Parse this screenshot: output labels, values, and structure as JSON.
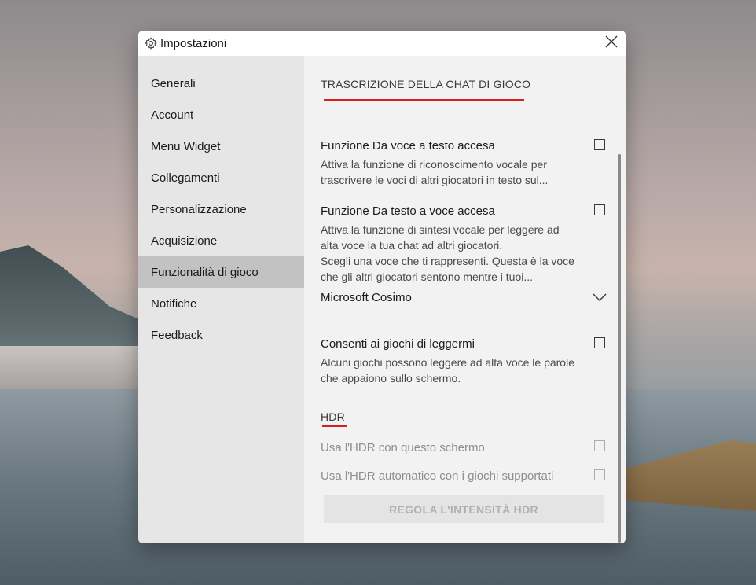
{
  "window": {
    "title": "Impostazioni",
    "settings_icon": "gear-icon",
    "close_icon": "close-icon"
  },
  "sidebar": {
    "items": [
      {
        "label": "Generali"
      },
      {
        "label": "Account"
      },
      {
        "label": "Menu Widget"
      },
      {
        "label": "Collegamenti"
      },
      {
        "label": "Personalizzazione"
      },
      {
        "label": "Acquisizione"
      },
      {
        "label": "Funzionalità di gioco",
        "active": true
      },
      {
        "label": "Notifiche"
      },
      {
        "label": "Feedback"
      }
    ]
  },
  "content": {
    "chat_section": {
      "title": "TRASCRIZIONE DELLA CHAT DI GIOCO",
      "speech_to_text": {
        "title": "Funzione Da voce a testo accesa",
        "desc_line1": "Attiva la funzione di riconoscimento vocale per",
        "desc_line2": "trascrivere le voci di altri giocatori in testo sul...",
        "checked": false
      },
      "text_to_speech": {
        "title": "Funzione Da testo a voce accesa",
        "desc_line1": "Attiva la funzione di sintesi vocale per leggere ad",
        "desc_line2": "alta voce la tua chat ad altri giocatori.",
        "desc_line3": "Scegli una voce che ti rappresenti. Questa è la voce",
        "desc_line4": "che gli altri giocatori sentono mentre i tuoi...",
        "checked": false
      },
      "voice_dropdown": {
        "selected": "Microsoft Cosimo",
        "icon": "chevron-down-icon"
      },
      "read_to_me": {
        "title": "Consenti ai giochi di leggermi",
        "desc_line1": "Alcuni giochi possono leggere ad alta voce le parole",
        "desc_line2": "che appaiono sullo schermo.",
        "checked": false
      }
    },
    "hdr_section": {
      "title": "HDR",
      "use_hdr": {
        "label": "Usa l'HDR con questo schermo",
        "checked": false,
        "disabled": true
      },
      "auto_hdr": {
        "label": "Usa l'HDR automatico con i giochi supportati",
        "checked": false,
        "disabled": true
      },
      "intensity_button": "REGOLA L'INTENSITÀ HDR"
    }
  },
  "colors": {
    "accent_underline": "#d81e1e",
    "sidebar_bg": "#e6e6e6",
    "sidebar_active": "#c2c2c2",
    "content_bg": "#f2f2f2"
  }
}
